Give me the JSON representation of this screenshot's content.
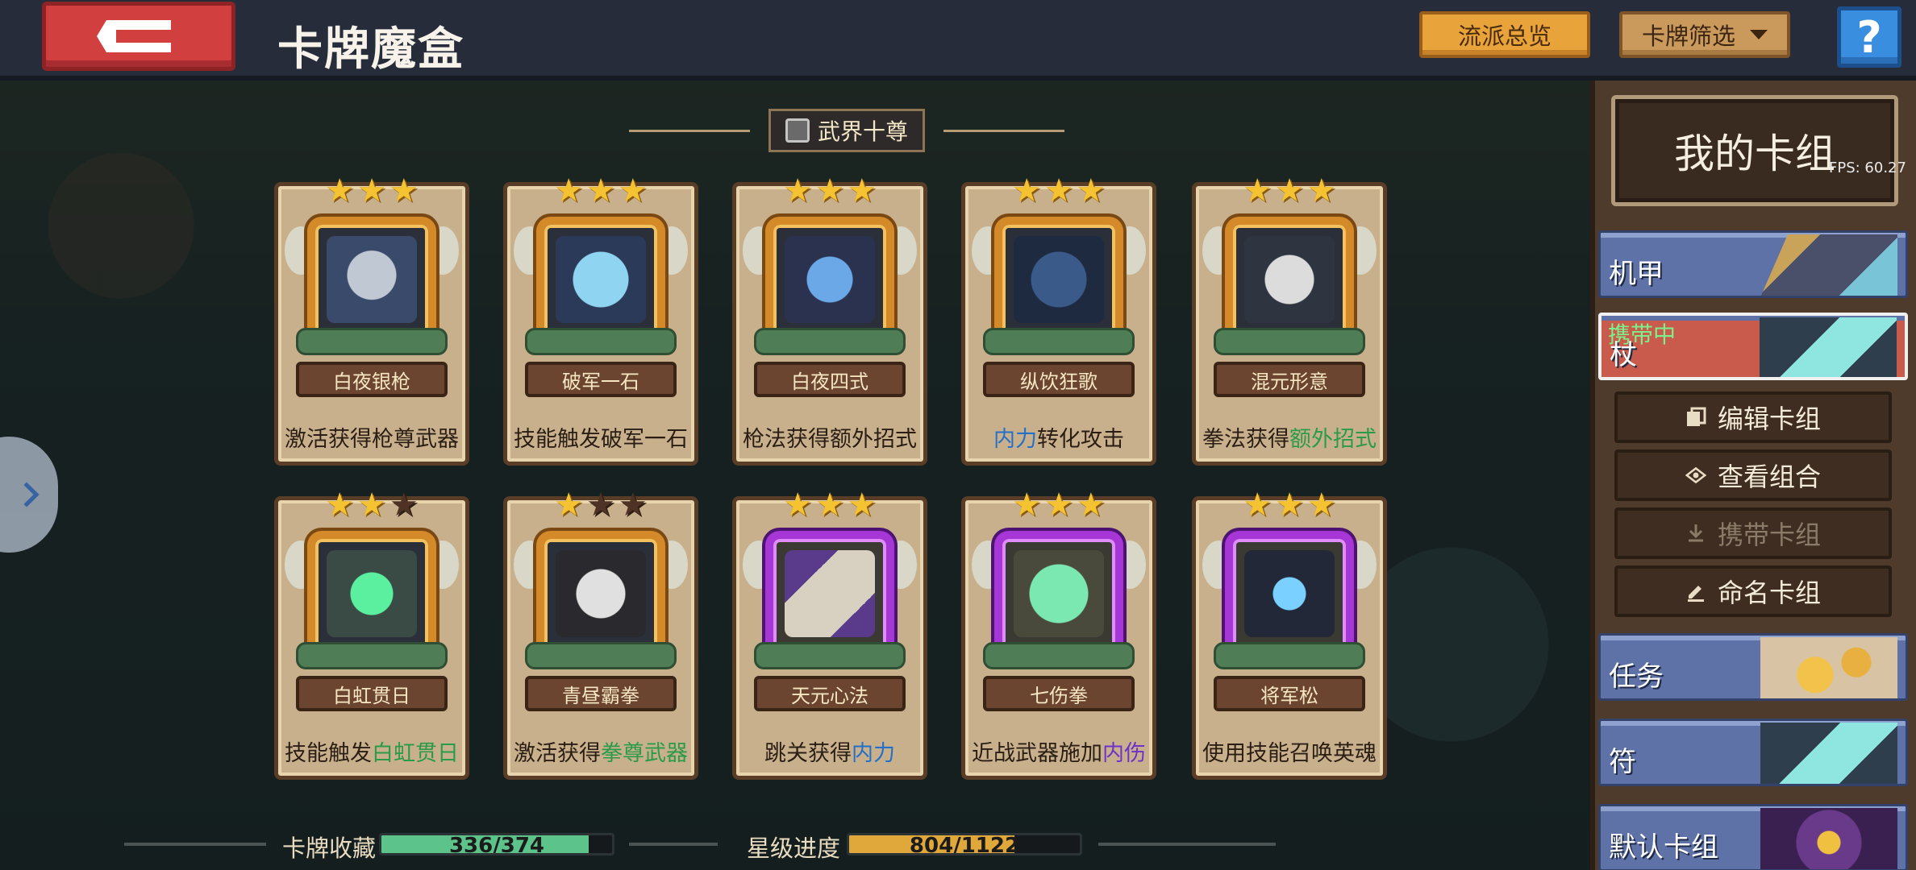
{
  "header": {
    "title": "卡牌魔盒",
    "school_overview_label": "流派总览",
    "filter_label": "卡牌筛选",
    "help_label": "?"
  },
  "section": {
    "title": "武界十尊"
  },
  "cards": [
    {
      "name": "白夜银枪",
      "stars": 3,
      "frame": "gold",
      "desc": [
        {
          "t": "激活获得枪尊武器",
          "c": ""
        }
      ]
    },
    {
      "name": "破军一石",
      "stars": 3,
      "frame": "gold",
      "desc": [
        {
          "t": "技能触发破军一石",
          "c": ""
        }
      ]
    },
    {
      "name": "白夜四式",
      "stars": 3,
      "frame": "gold",
      "desc": [
        {
          "t": "枪法获得额外招式",
          "c": ""
        }
      ]
    },
    {
      "name": "纵饮狂歌",
      "stars": 3,
      "frame": "gold",
      "desc": [
        {
          "t": "内力",
          "c": "blue"
        },
        {
          "t": "转化攻击",
          "c": ""
        }
      ]
    },
    {
      "name": "混元形意",
      "stars": 3,
      "frame": "gold",
      "desc": [
        {
          "t": "拳法获得",
          "c": ""
        },
        {
          "t": "额外招式",
          "c": "green"
        }
      ]
    },
    {
      "name": "白虹贯日",
      "stars": 2,
      "frame": "gold",
      "desc": [
        {
          "t": "技能触发",
          "c": ""
        },
        {
          "t": "白虹贯日",
          "c": "green"
        }
      ]
    },
    {
      "name": "青昼霸拳",
      "stars": 1,
      "frame": "gold",
      "desc": [
        {
          "t": "激活获得",
          "c": ""
        },
        {
          "t": "拳尊武器",
          "c": "green"
        }
      ]
    },
    {
      "name": "天元心法",
      "stars": 3,
      "frame": "purple",
      "desc": [
        {
          "t": "跳关获得",
          "c": ""
        },
        {
          "t": "内力",
          "c": "blue"
        }
      ]
    },
    {
      "name": "七伤拳",
      "stars": 3,
      "frame": "purple",
      "desc": [
        {
          "t": "近战武器施加",
          "c": ""
        },
        {
          "t": "内伤",
          "c": "purple"
        }
      ]
    },
    {
      "name": "将军松",
      "stars": 3,
      "frame": "purple",
      "desc": [
        {
          "t": "使用技能召唤英魂",
          "c": ""
        }
      ]
    }
  ],
  "progress": {
    "collection_label": "卡牌收藏",
    "collection_value": "336/374",
    "collection_fraction": 0.898,
    "star_label": "星级进度",
    "star_value": "804/1122",
    "star_fraction": 0.717
  },
  "deck_panel": {
    "title": "我的卡组",
    "fps": "FPS: 60.27",
    "decks": [
      {
        "label": "机甲",
        "active": false
      },
      {
        "label": "杖",
        "active": true,
        "carry_label": "携带中"
      },
      {
        "label": "任务",
        "active": false
      },
      {
        "label": "符",
        "active": false
      },
      {
        "label": "默认卡组",
        "active": false
      }
    ],
    "actions": [
      {
        "label": "编辑卡组",
        "icon": "copy-icon",
        "disabled": false
      },
      {
        "label": "查看组合",
        "icon": "eye-icon",
        "disabled": false
      },
      {
        "label": "携带卡组",
        "icon": "download-icon",
        "disabled": true
      },
      {
        "label": "命名卡组",
        "icon": "pen-icon",
        "disabled": false
      }
    ]
  },
  "colors": {
    "accent_gold": "#e8a43a",
    "back_red": "#d13f3f",
    "help_blue": "#3a8ee0",
    "collection_bar": "#5cc48a",
    "star_bar": "#e0a83a"
  }
}
